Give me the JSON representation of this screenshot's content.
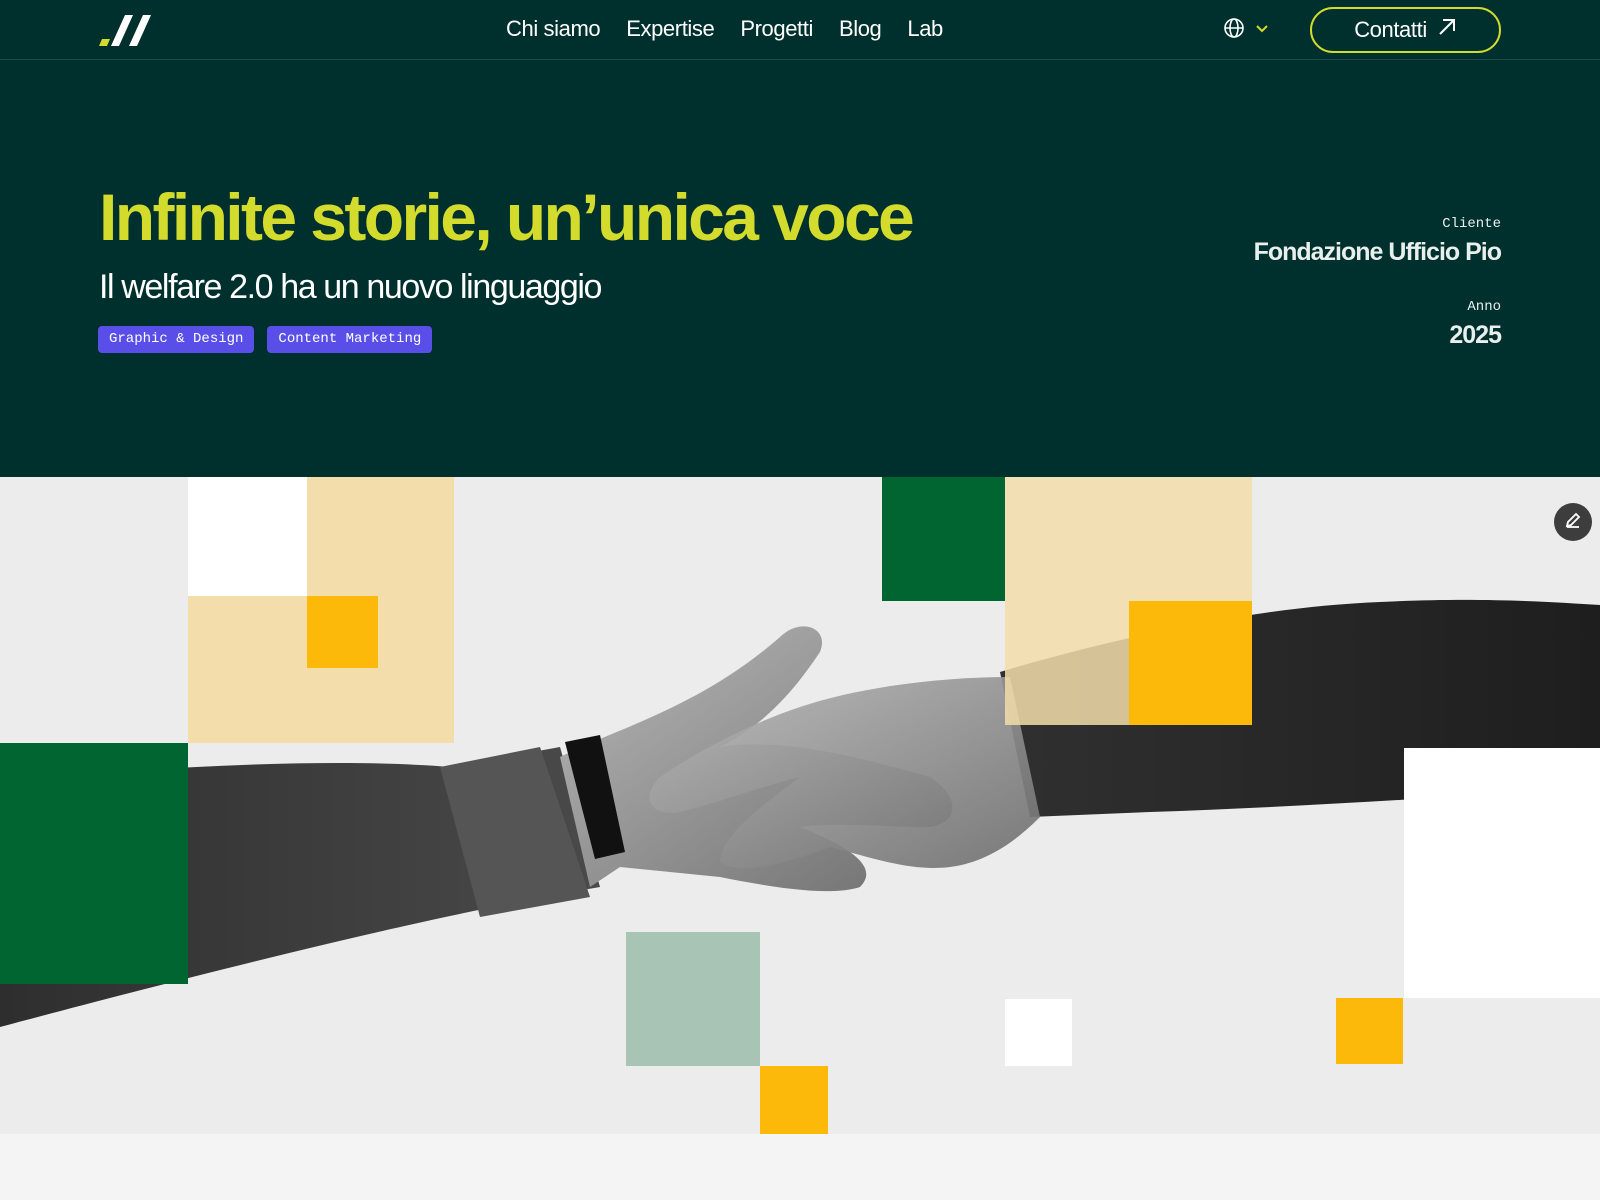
{
  "header": {
    "logo_icon": "double-slash-logo",
    "nav": [
      {
        "label": "Chi siamo"
      },
      {
        "label": "Expertise"
      },
      {
        "label": "Progetti"
      },
      {
        "label": "Blog"
      },
      {
        "label": "Lab"
      }
    ],
    "language_icon": "globe-icon",
    "contact_label": "Contatti",
    "contact_icon": "arrow-up-right-icon"
  },
  "hero": {
    "title": "Infinite storie, un’unica voce",
    "subtitle": "Il welfare 2.0 ha un nuovo linguaggio",
    "tags": [
      {
        "label": "Graphic & Design"
      },
      {
        "label": "Content Marketing"
      }
    ],
    "client_label": "Cliente",
    "client_value": "Fondazione Ufficio Pio",
    "year_label": "Anno",
    "year_value": "2025"
  },
  "image": {
    "description_icon": "handshake-photo",
    "edit_icon": "pencil-icon"
  },
  "colors": {
    "brand_dark": "#00302d",
    "accent_lime": "#d3dc2c",
    "tag_purple": "#5a4ee8",
    "square_green": "#006530",
    "square_yellow": "#fdb909",
    "square_beige": "#f3ddaa",
    "square_sage": "#a7c4b4"
  }
}
